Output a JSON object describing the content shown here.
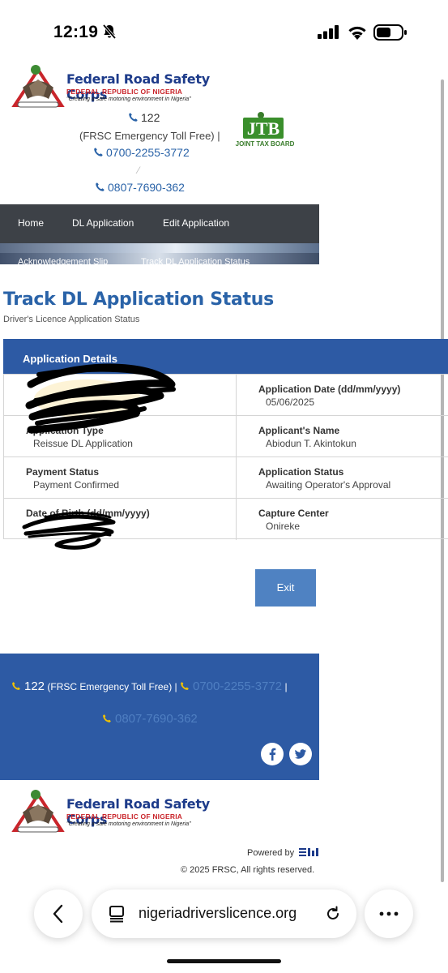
{
  "status_bar": {
    "time": "12:19"
  },
  "header": {
    "org_name": "Federal Road Safety Corps",
    "org_sub": "FEDERAL REPUBLIC OF NIGERIA",
    "org_tagline": "\"Creating a safe motoring environment in Nigeria\"",
    "toll_number": "122",
    "toll_label": "(FRSC Emergency Toll Free)  |",
    "phone1": "0700-2255-3772",
    "separator": "⁄",
    "phone2": "0807-7690-362",
    "jtb_letters": "JTB",
    "jtb_label": "JOINT TAX BOARD"
  },
  "nav": {
    "items": [
      {
        "label": "Home"
      },
      {
        "label": "DL Application"
      },
      {
        "label": "Edit Application"
      }
    ],
    "breadcrumb": [
      {
        "label": "Acknowledgement Slip"
      },
      {
        "label": "Track DL Application Status"
      }
    ]
  },
  "page": {
    "title": "Track DL Application Status",
    "subtitle": "Driver's Licence Application Status"
  },
  "details": {
    "header": "Application Details",
    "rows": [
      {
        "left": {
          "label": "",
          "value": ""
        },
        "right": {
          "label": "Application Date (dd/mm/yyyy)",
          "value": "05/06/2025"
        }
      },
      {
        "left": {
          "label": "Application Type",
          "value": "Reissue DL Application"
        },
        "right": {
          "label": "Applicant's Name",
          "value": "Abiodun T. Akintokun"
        }
      },
      {
        "left": {
          "label": "Payment Status",
          "value": "Payment Confirmed"
        },
        "right": {
          "label": "Application Status",
          "value": "Awaiting Operator's Approval"
        }
      },
      {
        "left": {
          "label": "Date of Birth (dd/mm/yyyy)",
          "value": ""
        },
        "right": {
          "label": "Capture Center",
          "value": "Onireke"
        }
      }
    ],
    "exit_label": "Exit"
  },
  "footer": {
    "toll_number": "122",
    "toll_label": "(FRSC Emergency Toll Free)  |",
    "phone1": "0700-2255-3772",
    "pipe": "|",
    "phone2": "0807-7690-362",
    "powered_by": "Powered by",
    "copyright": "© 2025 FRSC, All rights reserved."
  },
  "browser": {
    "url": "nigeriadriverslicence.org"
  },
  "colors": {
    "brand_blue": "#2d5aa4",
    "link_blue": "#2a63a8",
    "nav_dark": "#3d4147",
    "exit_blue": "#4f82c2",
    "footer_phone_icon": "#f2c200"
  }
}
